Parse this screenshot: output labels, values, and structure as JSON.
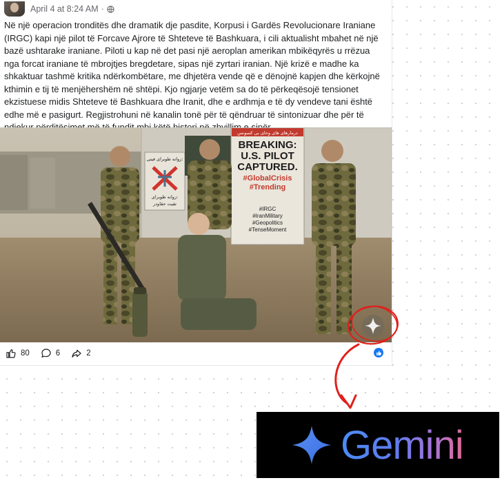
{
  "post": {
    "timestamp": "April 4 at 8:24 AM",
    "separator": "·",
    "body": "Në një operacion tronditës dhe dramatik dje pasdite, Korpusi i Gardës Revolucionare Iraniane (IRGC) kapi një pilot të Forcave Ajrore të Shteteve të Bashkuara, i cili aktualisht mbahet në një bazë ushtarake iraniane. Piloti u kap në det pasi një aeroplan amerikan mbikëqyrës u rrëzua nga forcat iraniane të mbrojtjes bregdetare, sipas një zyrtari iranian. Një krizë e madhe ka shkaktuar tashmë kritika ndërkombëtare, me dhjetëra vende që e dënojnë kapjen dhe kërkojnë kthimin e tij të menjëhershëm në shtëpi. Kjo ngjarje vetëm sa do të përkeqësojë tensionet ekzistuese midis Shteteve të Bashkuara dhe Iranit, dhe e ardhmja e të dy vendeve tani është edhe më e pasigurt. Regjistrohuni në kanalin tonë për të qëndruar të sintonizuar dhe për të ndjekur përditësimet më të fundit mbi këtë histori në zhvillim e sipër."
  },
  "image": {
    "poster_right": {
      "top_line": "درمارهاى هاى وحاى بى كسونس",
      "headline_1": "BREAKING:",
      "headline_2": "U.S. PILOT",
      "headline_3": "CAPTURED.",
      "tag_1": "#GlobalCrisis",
      "tag_2": "#Trending",
      "hashtags": [
        "#IRGC",
        "#IranMilitary",
        "#Geopolitics",
        "#TenseMoment"
      ]
    },
    "poster_left": {
      "top_line": "زوانه طوبراى فيتى:",
      "bottom_line": "زوانه طوبراى:",
      "bottom_line_2": "تقيت حقاودر"
    }
  },
  "footer": {
    "likes": "80",
    "comments": "6",
    "shares": "2"
  },
  "icons": {
    "like": "thumbs-up-icon",
    "comment": "comment-bubble-icon",
    "share": "share-arrow-icon",
    "globe": "globe-icon",
    "sparkle": "ai-sparkle-icon",
    "gemini_star": "gemini-star-icon"
  },
  "gemini": {
    "wordmark": "Gemini"
  },
  "colors": {
    "annotation_red": "#e0201c",
    "facebook_blue": "#1877f2",
    "gemini_blue": "#4b8bf5",
    "gemini_pink": "#e06a94"
  }
}
